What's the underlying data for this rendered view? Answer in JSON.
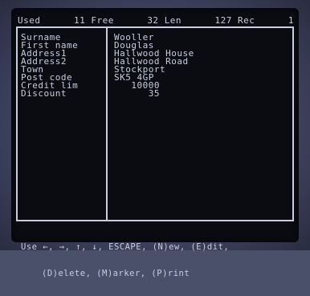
{
  "status": {
    "used_label": "Used",
    "used_value": "11",
    "free_label": "Free",
    "free_value": "32",
    "len_label": "Len",
    "len_value": "127",
    "rec_label": "Rec",
    "rec_value": "1"
  },
  "fields": [
    {
      "label": "Surname",
      "value": "Wooller"
    },
    {
      "label": "First name",
      "value": "Douglas"
    },
    {
      "label": "Address1",
      "value": "Hallwood House"
    },
    {
      "label": "Address2",
      "value": "Hallwood Road"
    },
    {
      "label": "Town",
      "value": "Stockport"
    },
    {
      "label": "Post code",
      "value": "SK5 4GP"
    },
    {
      "label": "Credit lim",
      "value": "   10000"
    },
    {
      "label": "Discount",
      "value": "      35"
    }
  ],
  "help": {
    "line1": "Use ←, →, ↑, ↓, ESCAPE, (N)ew, (E)dit,",
    "line2": "(D)elete, (M)arker, (P)rint"
  },
  "colors": {
    "screen_bg": "#0a0c12",
    "text": "#c9cde0"
  }
}
